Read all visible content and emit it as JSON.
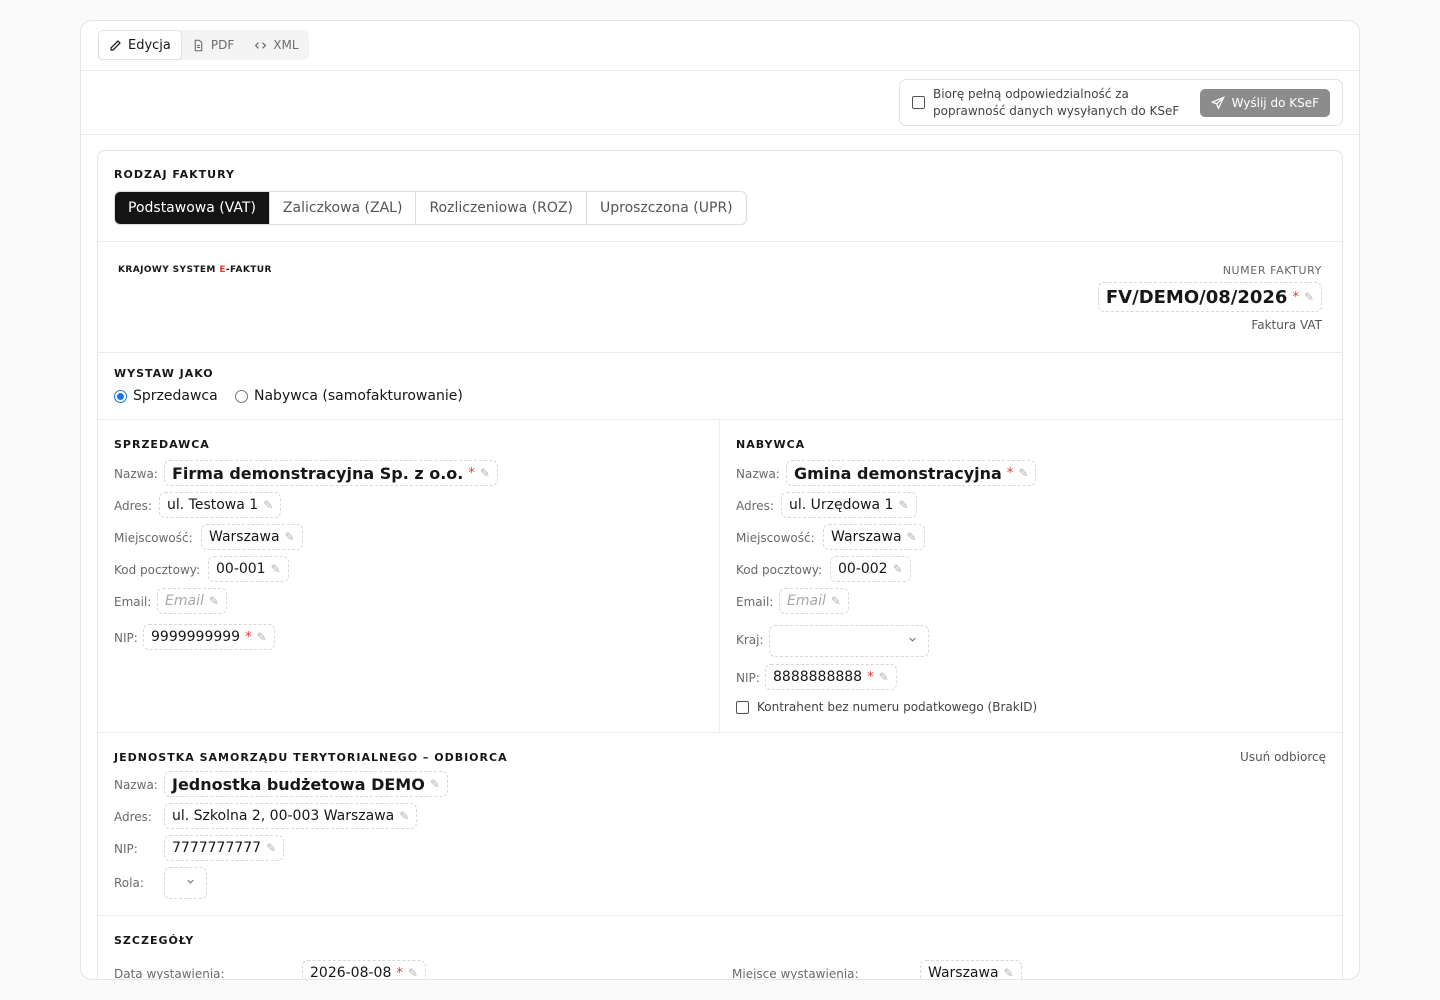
{
  "tabs": [
    {
      "label": "Edycja",
      "icon": "pencil-icon"
    },
    {
      "label": "PDF",
      "icon": "file-icon"
    },
    {
      "label": "XML",
      "icon": "code-icon"
    }
  ],
  "send": {
    "checkbox_text": "Biorę pełną odpowiedzialność za poprawność danych wysyłanych do KSeF",
    "button": "Wyślij do KSeF"
  },
  "invoice_type": {
    "title": "RODZAJ FAKTURY",
    "options": [
      "Podstawowa (VAT)",
      "Zaliczkowa (ZAL)",
      "Rozliczeniowa (ROZ)",
      "Uproszczona (UPR)"
    ],
    "selected": "Podstawowa (VAT)"
  },
  "header": {
    "logo_pre": "KRAJOWY SYSTEM ",
    "logo_e": "E",
    "logo_post": "-FAKTUR",
    "number_label": "NUMER FAKTURY",
    "number": "FV/DEMO/08/2026",
    "number_sub": "Faktura VAT"
  },
  "issue_as": {
    "title": "WYSTAW JAKO",
    "options": [
      "Sprzedawca",
      "Nabywca (samofakturowanie)"
    ],
    "selected": "Sprzedawca"
  },
  "seller": {
    "title": "SPRZEDAWCA",
    "labels": {
      "name": "Nazwa:",
      "address": "Adres:",
      "city": "Miejscowość:",
      "postal": "Kod pocztowy:",
      "email": "Email:",
      "nip": "NIP:"
    },
    "name": "Firma demonstracyjna Sp. z o.o.",
    "address": "ul. Testowa 1",
    "city": "Warszawa",
    "postal": "00-001",
    "email_placeholder": "Email",
    "nip": "9999999999"
  },
  "buyer": {
    "title": "NABYWCA",
    "labels": {
      "name": "Nazwa:",
      "address": "Adres:",
      "city": "Miejscowość:",
      "postal": "Kod pocztowy:",
      "email": "Email:",
      "country": "Kraj:",
      "nip": "NIP:"
    },
    "name": "Gmina demonstracyjna",
    "address": "ul. Urzędowa 1",
    "city": "Warszawa",
    "postal": "00-002",
    "email_placeholder": "Email",
    "country": "",
    "nip": "8888888888",
    "no_tax_id": "Kontrahent bez numeru podatkowego (BrakID)"
  },
  "recipient": {
    "title": "JEDNOSTKA SAMORZĄDU TERYTORIALNEGO – ODBIORCA",
    "remove": "Usuń odbiorcę",
    "labels": {
      "name": "Nazwa:",
      "address": "Adres:",
      "nip": "NIP:",
      "role": "Rola:"
    },
    "name": "Jednostka budżetowa DEMO",
    "address": "ul. Szkolna 2, 00-003 Warszawa",
    "nip": "7777777777",
    "role": ""
  },
  "details": {
    "title": "SZCZEGÓŁY",
    "issue_date_label": "Data wystawienia:",
    "issue_date": "2026-08-08",
    "issue_place_label": "Miejsce wystawienia:",
    "issue_place": "Warszawa"
  },
  "symbols": {
    "pen": "✎",
    "required": "*",
    "chevron": "⌄"
  }
}
